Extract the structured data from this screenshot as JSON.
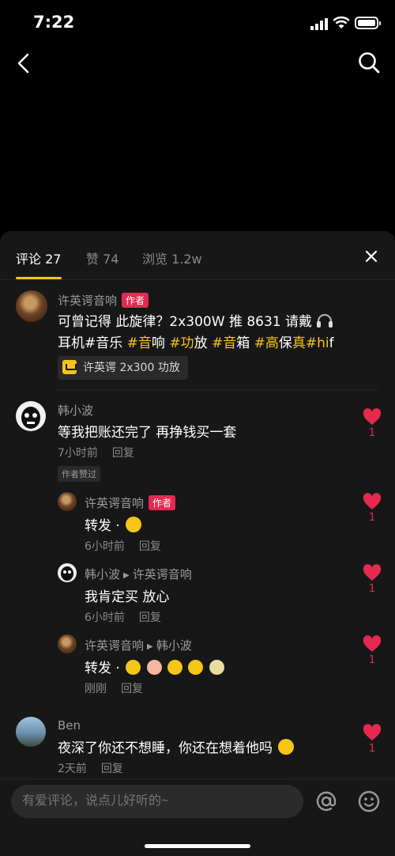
{
  "status_bar": {
    "time": "7:22"
  },
  "tabs": [
    {
      "label": "评论 27"
    },
    {
      "label": "赞 74"
    },
    {
      "label": "浏览 1.2w"
    }
  ],
  "author_badge": "作者",
  "liked_by_author": "作者赞过",
  "reply_label": "回复",
  "post": {
    "author": "许英谔音响",
    "line1": "可曾记得   此旋律？2x300W 推 8631 请戴",
    "line2_parts": [
      "耳机#音乐 ",
      "#音",
      "响 ",
      "#功",
      "放 ",
      "#音",
      "箱 ",
      "#高",
      "保",
      "真",
      "#hi",
      "f"
    ],
    "product": "许英谔 2x300 功放"
  },
  "comments": [
    {
      "author": "韩小波",
      "text": "等我把账还完了 再挣钱买一套",
      "time": "7小时前",
      "likes": "1"
    },
    {
      "author": "许英谔音响",
      "text": "转发 ·",
      "time": "6小时前",
      "likes": "1"
    },
    {
      "author": "韩小波",
      "reply_to": "许英谔音响",
      "text": "我肯定买 放心",
      "time": "6小时前",
      "likes": "1"
    },
    {
      "author": "许英谔音响",
      "reply_to": "韩小波",
      "text": "转发 ·",
      "time": "刚刚",
      "likes": "1"
    },
    {
      "author": "Ben",
      "text": "夜深了你还不想睡，你还在想着他吗",
      "time": "2天前",
      "likes": "1"
    }
  ],
  "input": {
    "placeholder": "有爱评论，说点儿好听的~"
  },
  "colors": {
    "accent": "#f5c518",
    "like": "#e6294f",
    "sheet": "#171717"
  }
}
